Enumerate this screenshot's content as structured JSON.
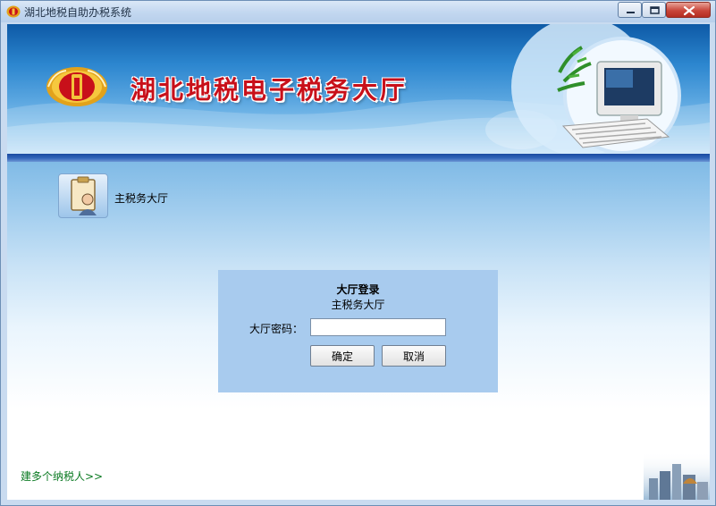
{
  "window": {
    "title": "湖北地税自助办税系统"
  },
  "banner": {
    "title": "湖北地税电子税务大厅"
  },
  "hall": {
    "label": "主税务大厅"
  },
  "login": {
    "title": "大厅登录",
    "subtitle": "主税务大厅",
    "password_label": "大厅密码：",
    "password_value": "",
    "ok_label": "确定",
    "cancel_label": "取消"
  },
  "footer": {
    "multi_taxpayer_link": "建多个纳税人>>"
  },
  "icons": {
    "app": "tax-emblem-icon",
    "hall": "clipboard-person-icon",
    "minimize": "minimize-icon",
    "maximize": "maximize-icon",
    "close": "close-icon"
  },
  "colors": {
    "banner_title": "#c8101a",
    "link": "#0b7a22",
    "login_panel": "#a8cbee"
  }
}
